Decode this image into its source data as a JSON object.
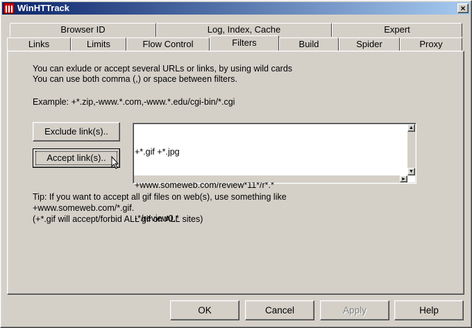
{
  "window": {
    "title": "WinHTTrack",
    "close_glyph": "×"
  },
  "tabs": {
    "row1": [
      "Browser ID",
      "Log, Index, Cache",
      "Expert"
    ],
    "row2": [
      "Links",
      "Limits",
      "Flow Control",
      "Filters",
      "Build",
      "Spider",
      "Proxy"
    ],
    "active": "Filters"
  },
  "filters": {
    "intro_line1": "You can exlude or accept several URLs or links, by using wild cards",
    "intro_line2": "You can use both comma (,) or space between filters.",
    "example": "Example: +*.zip,-www.*.com,-www.*.edu/cgi-bin/*.cgi",
    "exclude_label": "Exclude link(s)..",
    "accept_label": "Accept link(s)..",
    "filter_lines": [
      "+*.gif +*.jpg",
      "+www.someweb.com/review*11*/r*.*",
      "-*/review0.*"
    ],
    "tip_line1": "Tip: If you want to accept all gif files on web(s), use something like",
    "tip_line2": "+www.someweb.com/*.gif.",
    "tip_line3": "(+*.gif will accept/forbid ALL gif on ALL sites)"
  },
  "dialog_buttons": {
    "ok": "OK",
    "cancel": "Cancel",
    "apply": "Apply",
    "help": "Help"
  },
  "icons": [
    "app-icon",
    "close-icon",
    "scroll-up-icon",
    "scroll-down-icon",
    "scroll-right-icon",
    "mouse-cursor-icon"
  ]
}
